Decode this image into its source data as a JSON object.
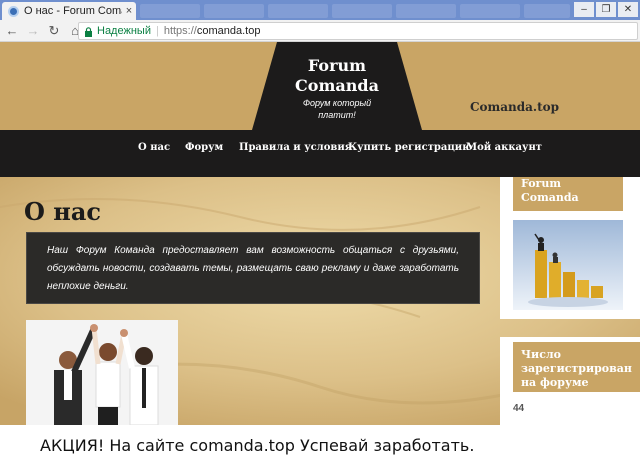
{
  "browser": {
    "tab_title": "О нас - Forum Comanda",
    "tab_close": "×",
    "window_controls": [
      "–",
      "❐",
      "✕"
    ],
    "back_icon": "←",
    "forward_icon": "→",
    "reload_icon": "↻",
    "home_icon": "⌂",
    "secure_label": "Надежный",
    "url_scheme": "https://",
    "url_host": "comanda.top"
  },
  "header": {
    "logo_title_line1": "Forum",
    "logo_title_line2": "Comanda",
    "logo_subtitle_line1": "Форум который",
    "logo_subtitle_line2": "платит!",
    "domain": "Comanda.top"
  },
  "nav": {
    "items": [
      "О нас",
      "Форум",
      "Правила и условия",
      "Купить регистрацию",
      "Мой аккаунт"
    ]
  },
  "main": {
    "heading": "О нас",
    "intro": "Наш Форум Команда предоставляет вам возможность общаться с друзьями, обсуждать новости, создавать темы, размещать сваю рекламу и даже заработать неплохие деньги."
  },
  "sidebar": {
    "widget1_title_line1": "Forum",
    "widget1_title_line2": "Comanda",
    "widget2_title_line1": "Число",
    "widget2_title_line2": "зарегистрирован",
    "widget2_title_line3": "на форуме",
    "registered_count": "44"
  },
  "promo": "АКЦИЯ! На сайте comanda.top Успевай заработать.",
  "colors": {
    "gold": "#c9a565",
    "dark": "#1c1b1b",
    "parchment": "#d8bd85"
  }
}
